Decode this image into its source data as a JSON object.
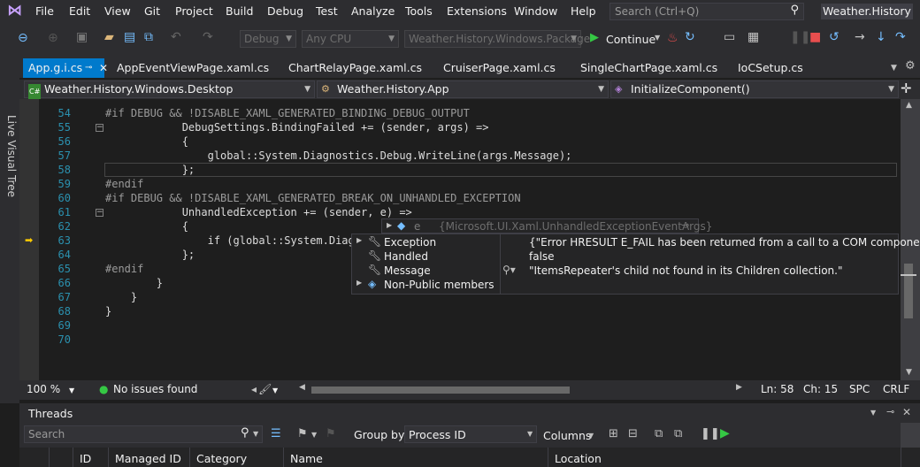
{
  "menu": {
    "items": [
      "File",
      "Edit",
      "View",
      "Git",
      "Project",
      "Build",
      "Debug",
      "Test",
      "Analyze",
      "Tools",
      "Extensions",
      "Window",
      "Help"
    ],
    "search_placeholder": "Search (Ctrl+Q)",
    "window_title": "Weather.History"
  },
  "toolbar": {
    "config": "Debug",
    "platform": "Any CPU",
    "startup_project": "Weather.History.Windows.Package",
    "continue_label": "Continue"
  },
  "left_strip": {
    "live_visual_tree": "Live Visual Tree"
  },
  "tabs": [
    {
      "label": "App.g.i.cs",
      "active": true
    },
    {
      "label": "AppEventViewPage.xaml.cs"
    },
    {
      "label": "ChartRelayPage.xaml.cs"
    },
    {
      "label": "CruiserPage.xaml.cs"
    },
    {
      "label": "SingleChartPage.xaml.cs"
    },
    {
      "label": "IoCSetup.cs"
    }
  ],
  "navbar": {
    "project": "Weather.History.Windows.Desktop",
    "type": "Weather.History.App",
    "member": "InitializeComponent()"
  },
  "code": {
    "line_numbers": [
      "54",
      "55",
      "56",
      "57",
      "58",
      "59",
      "60",
      "61",
      "62",
      "63",
      "64",
      "65",
      "66",
      "67",
      "68",
      "69",
      "70"
    ],
    "lines": [
      "#if DEBUG && !DISABLE_XAML_GENERATED_BINDING_DEBUG_OUTPUT",
      "            DebugSettings.BindingFailed += (sender, args) =>",
      "            {",
      "                global::System.Diagnostics.Debug.WriteLine(args.Message);",
      "            };",
      "#endif",
      "#if DEBUG && !DISABLE_XAML_GENERATED_BREAK_ON_UNHANDLED_EXCEPTION",
      "            UnhandledException += (sender, e) =>",
      "            {",
      "                if (global::System.Diagn",
      "            };",
      "#endif",
      "        }",
      "    }",
      "}",
      "",
      ""
    ]
  },
  "datatip": {
    "var_name": "e",
    "var_type": "{Microsoft.UI.Xaml.UnhandledExceptionEventArgs}",
    "rows": [
      {
        "name": "Exception",
        "value": "{\"Error HRESULT E_FAIL has been returned from a call to a COM component.\"}"
      },
      {
        "name": "Handled",
        "value": "false"
      },
      {
        "name": "Message",
        "value": "\"ItemsRepeater's child not found in its Children collection.\""
      },
      {
        "name": "Non-Public members",
        "value": ""
      }
    ]
  },
  "status": {
    "zoom": "100 %",
    "issues": "No issues found",
    "line": "Ln: 58",
    "col": "Ch: 15",
    "spc": "SPC",
    "crlf": "CRLF"
  },
  "threads": {
    "title": "Threads",
    "search_placeholder": "Search",
    "group_by_label": "Group by:",
    "group_by_value": "Process ID",
    "columns_label": "Columns",
    "headers": [
      "ID",
      "Managed ID",
      "Category",
      "Name",
      "Location"
    ]
  }
}
